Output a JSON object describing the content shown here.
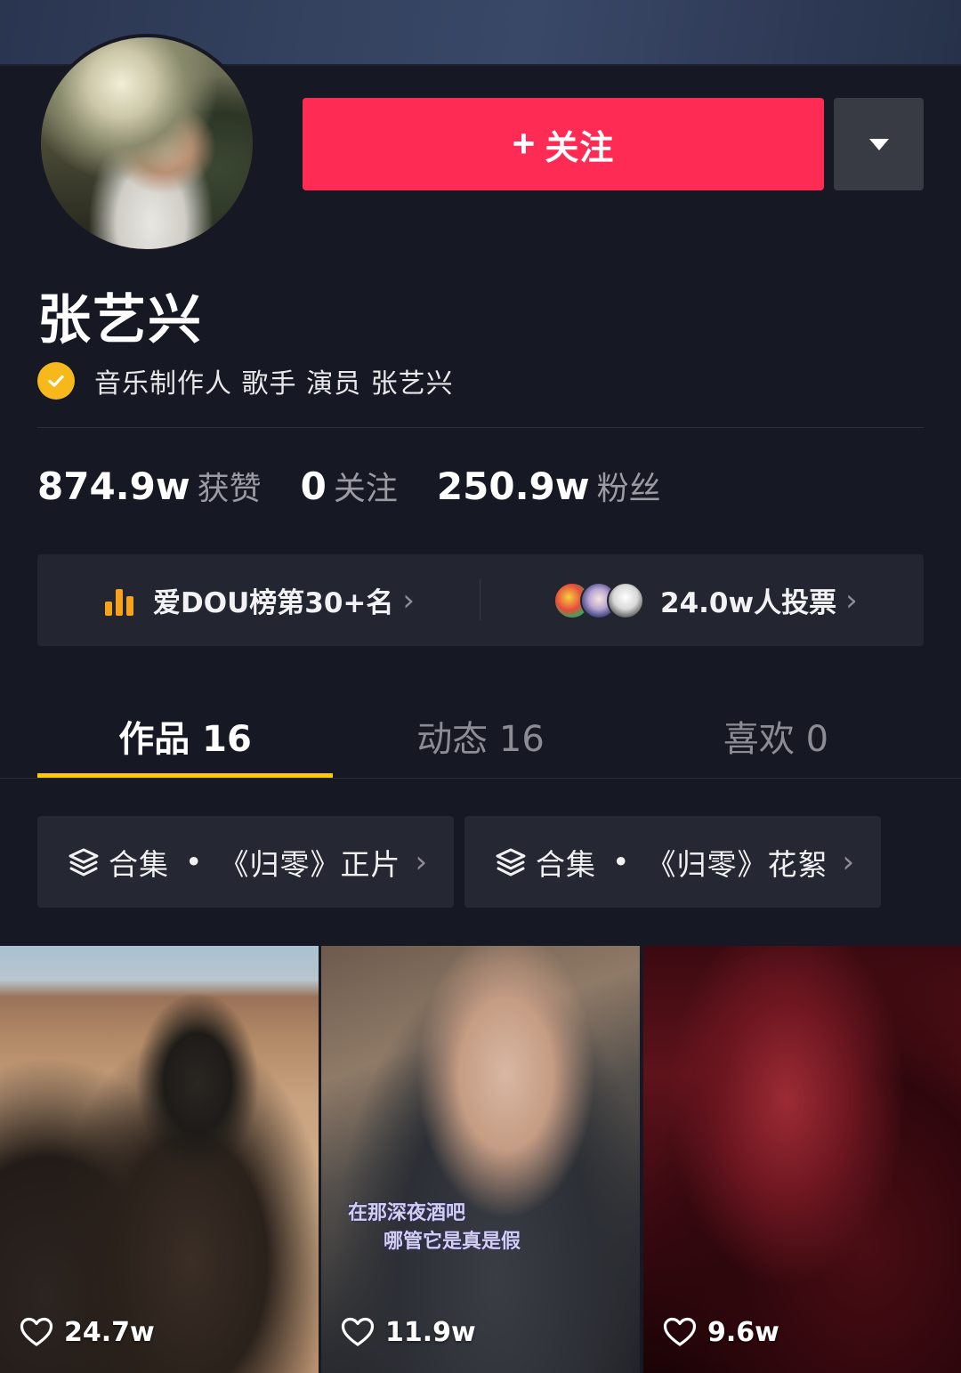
{
  "profile": {
    "name": "张艺兴",
    "verified_text": "音乐制作人 歌手 演员 张艺兴",
    "follow_label": "关注"
  },
  "stats": [
    {
      "value": "874.9w",
      "label": "获赞"
    },
    {
      "value": "0",
      "label": "关注"
    },
    {
      "value": "250.9w",
      "label": "粉丝"
    }
  ],
  "rank": {
    "label": "爱DOU榜第30+名",
    "votes": "24.0w人投票"
  },
  "tabs": [
    {
      "label": "作品 16"
    },
    {
      "label": "动态 16"
    },
    {
      "label": "喜欢 0"
    }
  ],
  "collections": [
    {
      "prefix": "合集",
      "title": "《归零》正片"
    },
    {
      "prefix": "合集",
      "title": "《归零》花絮"
    }
  ],
  "videos": [
    {
      "likes": "24.7w"
    },
    {
      "likes": "11.9w",
      "subtitle_line1": "在那深夜酒吧",
      "subtitle_line2": "哪管它是真是假"
    },
    {
      "likes": "9.6w"
    }
  ],
  "colors": {
    "background": "#161823",
    "follow_button": "#fe2c55",
    "tab_indicator": "#fdc900",
    "verified_badge": "#f7b81b"
  },
  "icons": [
    "plus-icon",
    "caret-down-icon",
    "verified-check-icon",
    "bar-chart-icon",
    "chevron-right-icon",
    "layers-icon",
    "heart-icon"
  ]
}
